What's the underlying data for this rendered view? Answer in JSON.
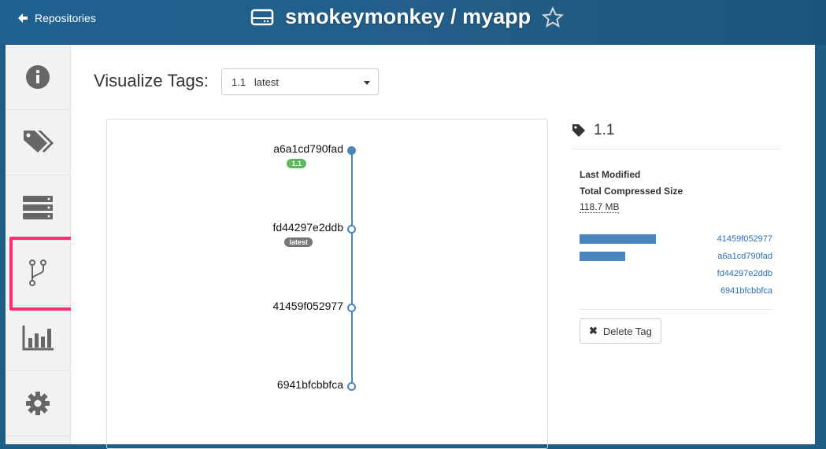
{
  "header": {
    "back_label": "Repositories",
    "title": "smokeymonkey / myapp"
  },
  "sidebar": {
    "items": [
      "info",
      "tags",
      "layers",
      "visualize-tags",
      "usage-logs",
      "settings"
    ],
    "active": "visualize-tags"
  },
  "main": {
    "visualize_label": "Visualize Tags:",
    "select": {
      "tag": "1.1",
      "secondary": "latest"
    }
  },
  "graph": {
    "nodes": [
      {
        "id": "a6a1cd790fad",
        "badge": "1.1",
        "badge_color": "#5cb85c"
      },
      {
        "id": "fd44297e2ddb",
        "badge": "latest",
        "badge_color": "#777777"
      },
      {
        "id": "41459f052977"
      },
      {
        "id": "6941bfcbbfca"
      }
    ]
  },
  "details": {
    "tag": "1.1",
    "last_modified_label": "Last Modified",
    "size_label": "Total Compressed Size",
    "size": "118.7 MB",
    "layers": [
      {
        "id": "41459f052977",
        "fraction": 1.0
      },
      {
        "id": "a6a1cd790fad",
        "fraction": 0.6
      },
      {
        "id": "fd44297e2ddb",
        "fraction": 0
      },
      {
        "id": "6941bfcbbfca",
        "fraction": 0
      }
    ],
    "delete_label": "Delete Tag"
  }
}
